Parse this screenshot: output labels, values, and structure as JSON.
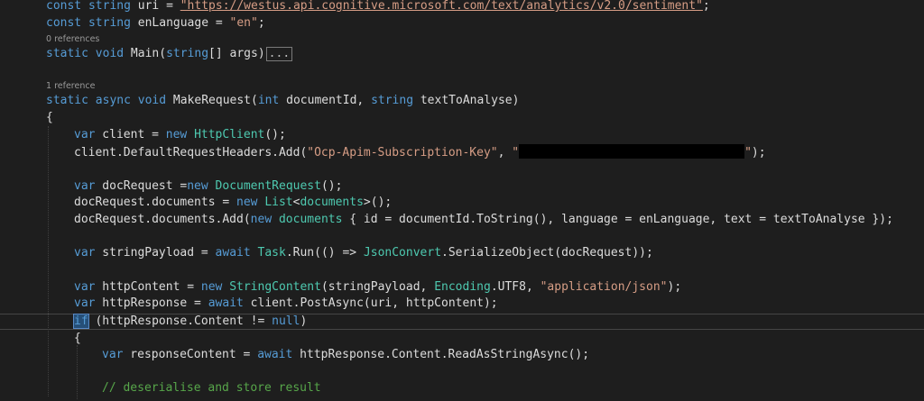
{
  "code": {
    "l1": {
      "kw1": "const",
      "ty": "string",
      "name": " uri = ",
      "url": "\"https://westus.api.cognitive.microsoft.com/text/analytics/v2.0/sentiment\"",
      "end": ";"
    },
    "l2": {
      "kw1": "const",
      "ty": "string",
      "name": " enLanguage = ",
      "str": "\"en\"",
      "end": ";"
    },
    "lens_main": "0 references",
    "l3": {
      "kw1": "static",
      "kw2": "void",
      "name": " Main(",
      "ty": "string",
      "rest": "[] args)",
      "collapsed": "..."
    },
    "lens_make": "1 reference",
    "l4": {
      "kw1": "static",
      "kw2": "async",
      "kw3": "void",
      "name": " MakeRequest(",
      "kw4": "int",
      "mid": " documentId, ",
      "ty": "string",
      "rest": " textToAnalyse)"
    },
    "l5": "{",
    "l6": {
      "kw": "var",
      "a": " client = ",
      "kw2": "new",
      "ty": "HttpClient",
      "end": "();"
    },
    "l7": {
      "a": "client.DefaultRequestHeaders.Add(",
      "str1": "\"Ocp-Apim-Subscription-Key\"",
      "b": ", ",
      "str2": "\"",
      "str3": "\"",
      "end": ");"
    },
    "l8": {
      "kw": "var",
      "a": " docRequest =",
      "kw2": "new",
      "ty": "DocumentRequest",
      "end": "();"
    },
    "l9": {
      "a": "docRequest.documents = ",
      "kw": "new",
      "ty": "List",
      "lt": "<",
      "ty2": "documents",
      "end": ">();"
    },
    "l10": {
      "a": "docRequest.documents.Add(",
      "kw": "new",
      "ty": "documents",
      "end": " { id = documentId.ToString(), language = enLanguage, text = textToAnalyse });"
    },
    "l11": {
      "kw": "var",
      "a": " stringPayload = ",
      "kw2": "await",
      "ty": "Task",
      "b": ".Run(() => ",
      "ty2": "JsonConvert",
      "end": ".SerializeObject(docRequest));"
    },
    "l12": {
      "kw": "var",
      "a": " httpContent = ",
      "kw2": "new",
      "ty": "StringContent",
      "b": "(stringPayload, ",
      "ty2": "Encoding",
      "c": ".UTF8, ",
      "str": "\"application/json\"",
      "end": ");"
    },
    "l13": {
      "kw": "var",
      "a": " httpResponse = ",
      "kw2": "await",
      "end": " client.PostAsync(uri, httpContent);"
    },
    "l14": {
      "kw": "if",
      "a": " (httpResponse.Content != ",
      "kw2": "null",
      "end": ")"
    },
    "l15": "{",
    "l16": {
      "kw": "var",
      "a": " responseContent = ",
      "kw2": "await",
      "end": " httpResponse.Content.ReadAsStringAsync();"
    },
    "l17": "// deserialise and store result"
  }
}
